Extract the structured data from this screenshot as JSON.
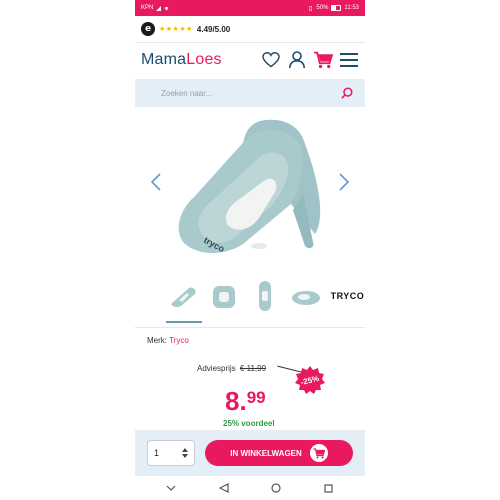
{
  "statusbar": {
    "carrier": "KPN",
    "battery": "50%",
    "time": "11:53"
  },
  "rating": {
    "logo_letter": "e",
    "stars": "★★★★★",
    "score": "4.49/5.00"
  },
  "header": {
    "logo_part1": "Mama",
    "logo_part2": "Loes"
  },
  "search": {
    "placeholder": "Zoeken naar..."
  },
  "product": {
    "brand_label": "Merk:",
    "brand_name": "Tryco",
    "thumb_logo": "TRYCO"
  },
  "price": {
    "advies_label": "Adviesprijs",
    "old_price": "€ 11,99",
    "discount": "-25%",
    "integer": "8.",
    "decimals": "99",
    "savings": "25% voordeel"
  },
  "cart": {
    "quantity": "1",
    "button_label": "IN WINKELWAGEN"
  },
  "colors": {
    "brand_pink": "#e8195f",
    "brand_navy": "#1b4d6e",
    "light_blue": "#e4eef7",
    "product_teal": "#9fc3c6"
  }
}
